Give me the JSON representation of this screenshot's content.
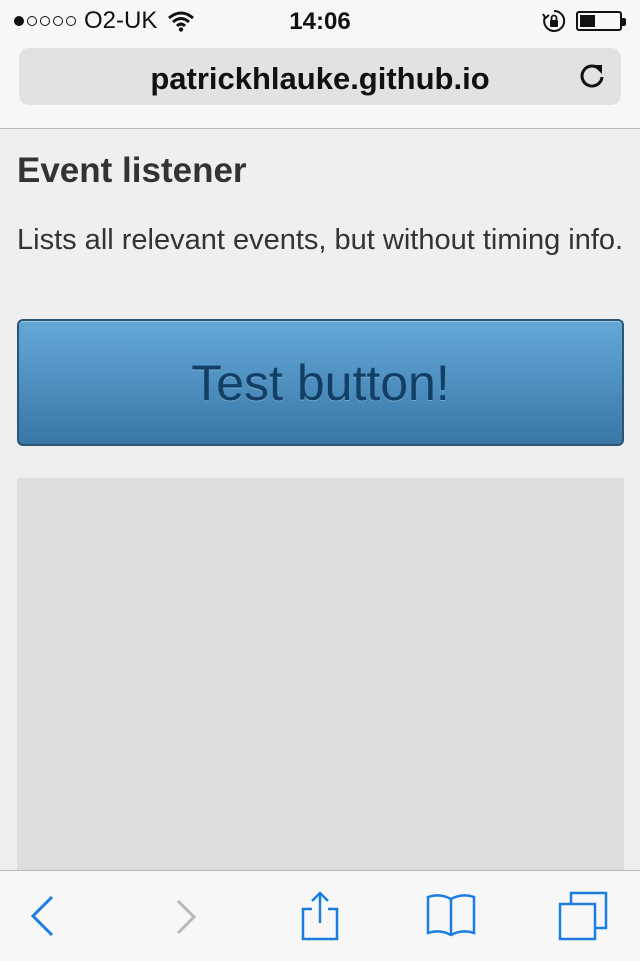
{
  "status_bar": {
    "signal_dots": [
      true,
      false,
      false,
      false,
      false
    ],
    "carrier": "O2-UK",
    "time": "14:06",
    "icons": [
      "wifi-icon",
      "orientation-lock-icon",
      "battery-icon"
    ],
    "battery_level": 0.4
  },
  "browser": {
    "url": "patrickhlauke.github.io",
    "accent_color": "#1a7de0",
    "toolbar": [
      "back",
      "forward",
      "share",
      "bookmarks",
      "tabs"
    ],
    "forward_enabled": false
  },
  "page": {
    "title": "Event listener",
    "description": "Lists all relevant events, but without timing info.",
    "button_label": "Test button!"
  }
}
